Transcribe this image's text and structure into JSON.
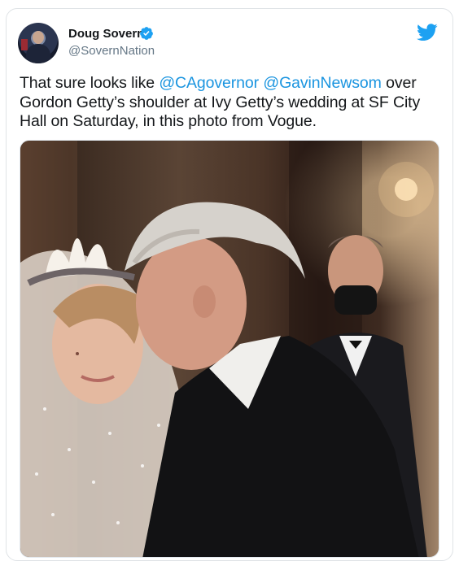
{
  "author": {
    "display_name": "Doug Sovern",
    "handle": "@SovernNation",
    "verified": true,
    "avatar_icon": "profile-avatar"
  },
  "platform_icon": "twitter-bird-icon",
  "tweet": {
    "text_1": "That sure looks like ",
    "mention_1": "@CAgovernor",
    "text_2": " ",
    "mention_2": "@GavinNewsom",
    "text_3": " over Gordon Getty’s shoulder at Ivy Getty’s wedding at SF City Hall on Saturday, in this photo from Vogue."
  },
  "colors": {
    "brand": "#1da1f2",
    "mention": "#1b95e0",
    "text": "#14171a",
    "secondary": "#657786"
  }
}
